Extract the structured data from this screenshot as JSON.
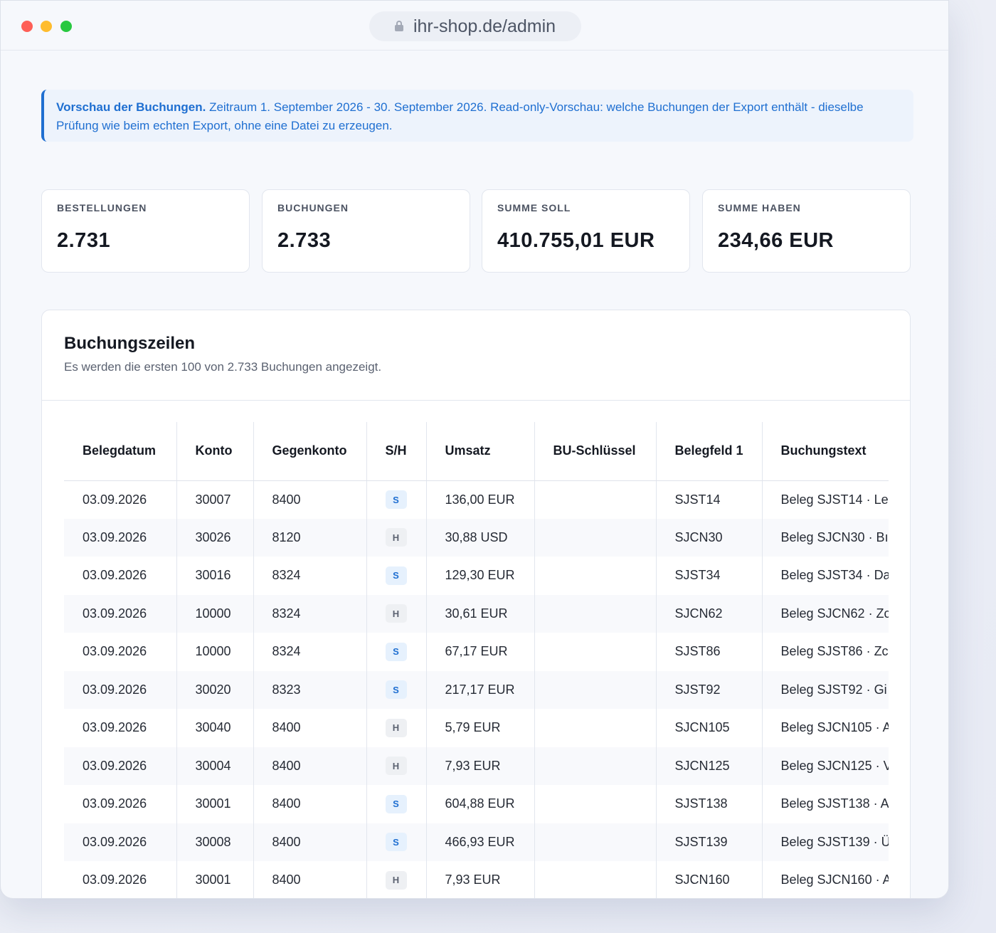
{
  "browser": {
    "url": "ihr-shop.de/admin"
  },
  "notice": {
    "title": "Vorschau der Buchungen.",
    "text": "Zeitraum 1. September 2026 - 30. September 2026. Read-only-Vorschau: welche Buchungen der Export enthält - dieselbe Prüfung wie beim echten Export, ohne eine Datei zu erzeugen."
  },
  "stats": [
    {
      "label": "BESTELLUNGEN",
      "value": "2.731"
    },
    {
      "label": "BUCHUNGEN",
      "value": "2.733"
    },
    {
      "label": "SUMME SOLL",
      "value": "410.755,01 EUR"
    },
    {
      "label": "SUMME HABEN",
      "value": "234,66 EUR"
    }
  ],
  "table": {
    "title": "Buchungszeilen",
    "subtitle": "Es werden die ersten 100 von 2.733 Buchungen angezeigt.",
    "columns": [
      "Belegdatum",
      "Konto",
      "Gegenkonto",
      "S/H",
      "Umsatz",
      "BU-Schlüssel",
      "Belegfeld 1",
      "Buchungstext"
    ],
    "rows": [
      {
        "date": "03.09.2026",
        "konto": "30007",
        "gegenkonto": "8400",
        "sh": "S",
        "umsatz": "136,00 EUR",
        "bu": "",
        "beleg": "SJST14",
        "text": "Beleg SJST14 · Le"
      },
      {
        "date": "03.09.2026",
        "konto": "30026",
        "gegenkonto": "8120",
        "sh": "H",
        "umsatz": "30,88 USD",
        "bu": "",
        "beleg": "SJCN30",
        "text": "Beleg SJCN30 · Bı"
      },
      {
        "date": "03.09.2026",
        "konto": "30016",
        "gegenkonto": "8324",
        "sh": "S",
        "umsatz": "129,30 EUR",
        "bu": "",
        "beleg": "SJST34",
        "text": "Beleg SJST34 · Da"
      },
      {
        "date": "03.09.2026",
        "konto": "10000",
        "gegenkonto": "8324",
        "sh": "H",
        "umsatz": "30,61 EUR",
        "bu": "",
        "beleg": "SJCN62",
        "text": "Beleg SJCN62 · Zc"
      },
      {
        "date": "03.09.2026",
        "konto": "10000",
        "gegenkonto": "8324",
        "sh": "S",
        "umsatz": "67,17 EUR",
        "bu": "",
        "beleg": "SJST86",
        "text": "Beleg SJST86 · Zc"
      },
      {
        "date": "03.09.2026",
        "konto": "30020",
        "gegenkonto": "8323",
        "sh": "S",
        "umsatz": "217,17 EUR",
        "bu": "",
        "beleg": "SJST92",
        "text": "Beleg SJST92 · Gi"
      },
      {
        "date": "03.09.2026",
        "konto": "30040",
        "gegenkonto": "8400",
        "sh": "H",
        "umsatz": "5,79 EUR",
        "bu": "",
        "beleg": "SJCN105",
        "text": "Beleg SJCN105 · A"
      },
      {
        "date": "03.09.2026",
        "konto": "30004",
        "gegenkonto": "8400",
        "sh": "H",
        "umsatz": "7,93 EUR",
        "bu": "",
        "beleg": "SJCN125",
        "text": "Beleg SJCN125 · V"
      },
      {
        "date": "03.09.2026",
        "konto": "30001",
        "gegenkonto": "8400",
        "sh": "S",
        "umsatz": "604,88 EUR",
        "bu": "",
        "beleg": "SJST138",
        "text": "Beleg SJST138 · A"
      },
      {
        "date": "03.09.2026",
        "konto": "30008",
        "gegenkonto": "8400",
        "sh": "S",
        "umsatz": "466,93 EUR",
        "bu": "",
        "beleg": "SJST139",
        "text": "Beleg SJST139 · Ü"
      },
      {
        "date": "03.09.2026",
        "konto": "30001",
        "gegenkonto": "8400",
        "sh": "H",
        "umsatz": "7,93 EUR",
        "bu": "",
        "beleg": "SJCN160",
        "text": "Beleg SJCN160 · A"
      }
    ]
  }
}
